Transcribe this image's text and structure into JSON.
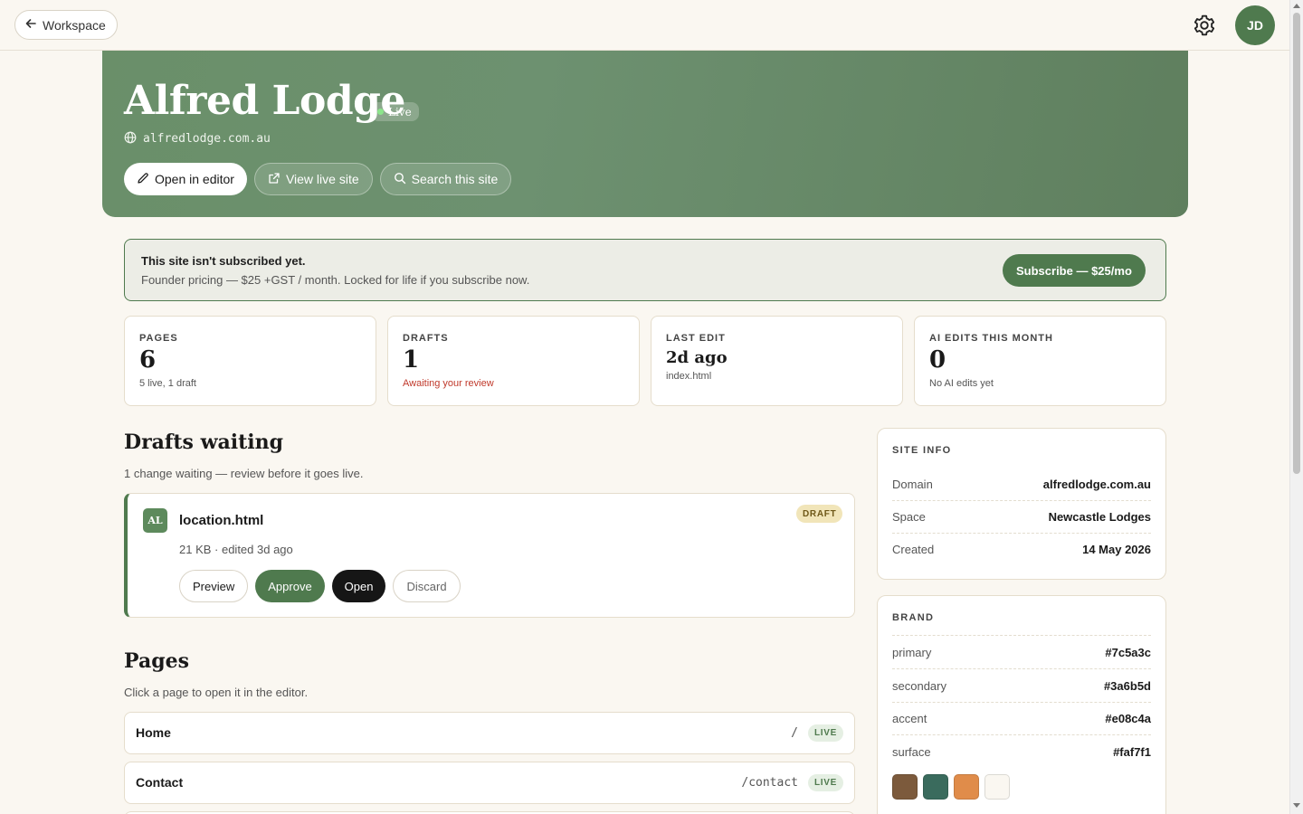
{
  "topbar": {
    "back_label": "Workspace",
    "avatar_initials": "JD"
  },
  "hero": {
    "title": "Alfred Lodge",
    "status": "Live",
    "domain": "alfredlodge.com.au",
    "buttons": {
      "open_editor": "Open in editor",
      "view_live": "View live site",
      "search": "Search this site"
    }
  },
  "subscribe": {
    "title": "This site isn't subscribed yet.",
    "description": "Founder pricing — $25 +GST / month. Locked for life if you subscribe now.",
    "button": "Subscribe — $25/mo"
  },
  "stats": [
    {
      "label": "PAGES",
      "value": "6",
      "sub": "5 live, 1 draft"
    },
    {
      "label": "DRAFTS",
      "value": "1",
      "sub": "Awaiting your review"
    },
    {
      "label": "LAST EDIT",
      "value": "2d ago",
      "sub": "index.html"
    },
    {
      "label": "AI EDITS THIS MONTH",
      "value": "0",
      "sub": "No AI edits yet"
    }
  ],
  "drafts": {
    "heading": "Drafts waiting",
    "subheading": "1 change waiting — review before it goes live.",
    "items": [
      {
        "icon_text": "AL",
        "name": "location.html",
        "meta": "21 KB · edited 3d ago",
        "badge": "DRAFT",
        "actions": {
          "preview": "Preview",
          "approve": "Approve",
          "open": "Open",
          "discard": "Discard"
        }
      }
    ]
  },
  "pages": {
    "heading": "Pages",
    "subheading": "Click a page to open it in the editor.",
    "items": [
      {
        "name": "Home",
        "path": "/",
        "status": "LIVE"
      },
      {
        "name": "Contact",
        "path": "/contact",
        "status": "LIVE"
      }
    ]
  },
  "site_info": {
    "title": "SITE INFO",
    "rows": [
      {
        "key": "Domain",
        "value": "alfredlodge.com.au"
      },
      {
        "key": "Space",
        "value": "Newcastle Lodges"
      },
      {
        "key": "Created",
        "value": "14 May 2026"
      }
    ]
  },
  "brand": {
    "title": "BRAND",
    "rows": [
      {
        "key": "primary",
        "value": "#7c5a3c"
      },
      {
        "key": "secondary",
        "value": "#3a6b5d"
      },
      {
        "key": "accent",
        "value": "#e08c4a"
      },
      {
        "key": "surface",
        "value": "#faf7f1"
      }
    ]
  },
  "colors": {
    "accent_green": "#4f7a4e",
    "warn": "#c0392b",
    "background": "#faf7f1"
  }
}
